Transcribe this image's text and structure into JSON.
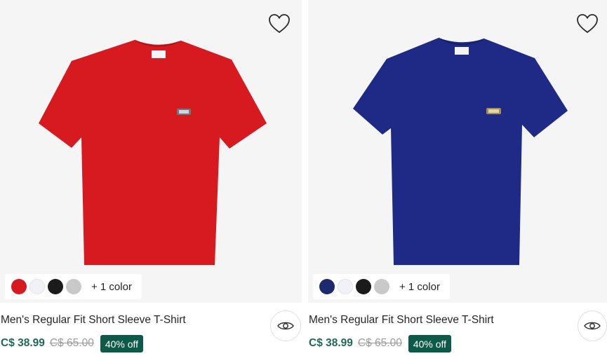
{
  "products": [
    {
      "name": "Men's Regular Fit Short Sleeve T-Shirt",
      "price": "C$ 38.99",
      "original_price": "C$ 65.00",
      "discount_badge": "40% off",
      "shirt_color": "#d71920",
      "swatches": [
        {
          "color": "#d71920",
          "selected": true
        },
        {
          "color": "#f1f2f7",
          "selected": false
        },
        {
          "color": "#1b1b1b",
          "selected": false
        },
        {
          "color": "#c9c9c9",
          "selected": false
        }
      ],
      "more_colors": "+ 1 color",
      "wishlist_icon": "heart-icon",
      "quick_view_icon": "eye-icon"
    },
    {
      "name": "Men's Regular Fit Short Sleeve T-Shirt",
      "price": "C$ 38.99",
      "original_price": "C$ 65.00",
      "discount_badge": "40% off",
      "shirt_color": "#1e2a86",
      "swatches": [
        {
          "color": "#1e2a6e",
          "selected": true
        },
        {
          "color": "#f1f2f7",
          "selected": false
        },
        {
          "color": "#1b1b1b",
          "selected": false
        },
        {
          "color": "#c9c9c9",
          "selected": false
        }
      ],
      "more_colors": "+ 1 color",
      "wishlist_icon": "heart-icon",
      "quick_view_icon": "eye-icon"
    }
  ],
  "colors": {
    "price_green": "#1d6a57",
    "badge_green": "#0e5a4a",
    "image_background": "#f5f5f5"
  }
}
